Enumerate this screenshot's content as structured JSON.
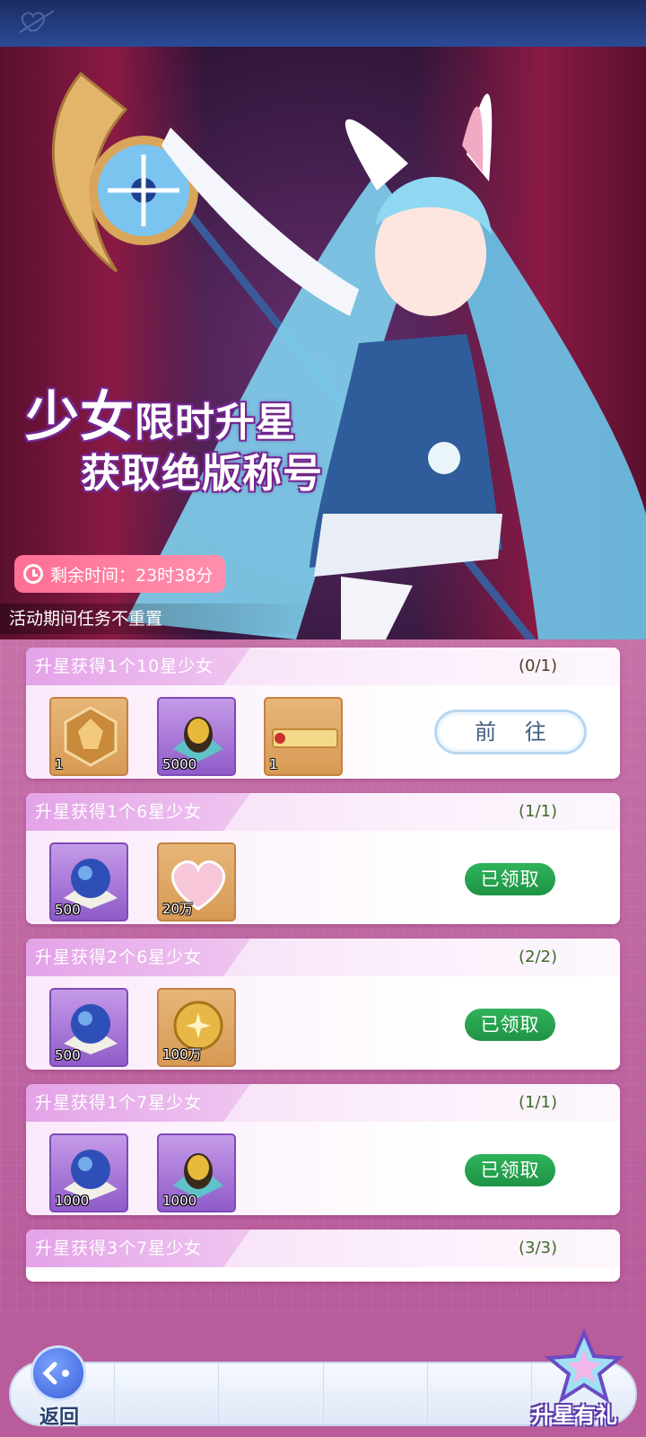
{
  "banner": {
    "headline_line1_big": "少女",
    "headline_line1_rest": "限时升星",
    "headline_line2": "获取绝版称号",
    "timer_label": "剩余时间：23时38分",
    "notice": "活动期间任务不重置"
  },
  "tasks": [
    {
      "title": "升星获得1个10星少女",
      "progress": "(0/1)",
      "action": "前 往",
      "rewards": [
        {
          "icon": "title-badge-icon",
          "qty": "1"
        },
        {
          "icon": "golden-egg-icon",
          "qty": "5000"
        },
        {
          "icon": "title-scroll-icon",
          "qty": "1"
        }
      ]
    },
    {
      "title": "升星获得1个6星少女",
      "progress": "(1/1)",
      "action": "已领取",
      "rewards": [
        {
          "icon": "crystal-orb-icon",
          "qty": "500"
        },
        {
          "icon": "exp-heart-icon",
          "qty": "20万"
        }
      ]
    },
    {
      "title": "升星获得2个6星少女",
      "progress": "(2/2)",
      "action": "已领取",
      "rewards": [
        {
          "icon": "crystal-orb-icon",
          "qty": "500"
        },
        {
          "icon": "gold-coin-icon",
          "qty": "100万"
        }
      ]
    },
    {
      "title": "升星获得1个7星少女",
      "progress": "(1/1)",
      "action": "已领取",
      "rewards": [
        {
          "icon": "crystal-orb-icon",
          "qty": "1000"
        },
        {
          "icon": "golden-egg-icon",
          "qty": "1000"
        }
      ]
    },
    {
      "title": "升星获得3个7星少女",
      "progress": "(3/3)"
    }
  ],
  "bottom": {
    "back_label": "返回",
    "star_gift_label": "升星有礼"
  },
  "colors": {
    "accent_pink": "#ff7a9c",
    "claimed_green": "#24a04f",
    "list_bg": "#b95d9a"
  }
}
